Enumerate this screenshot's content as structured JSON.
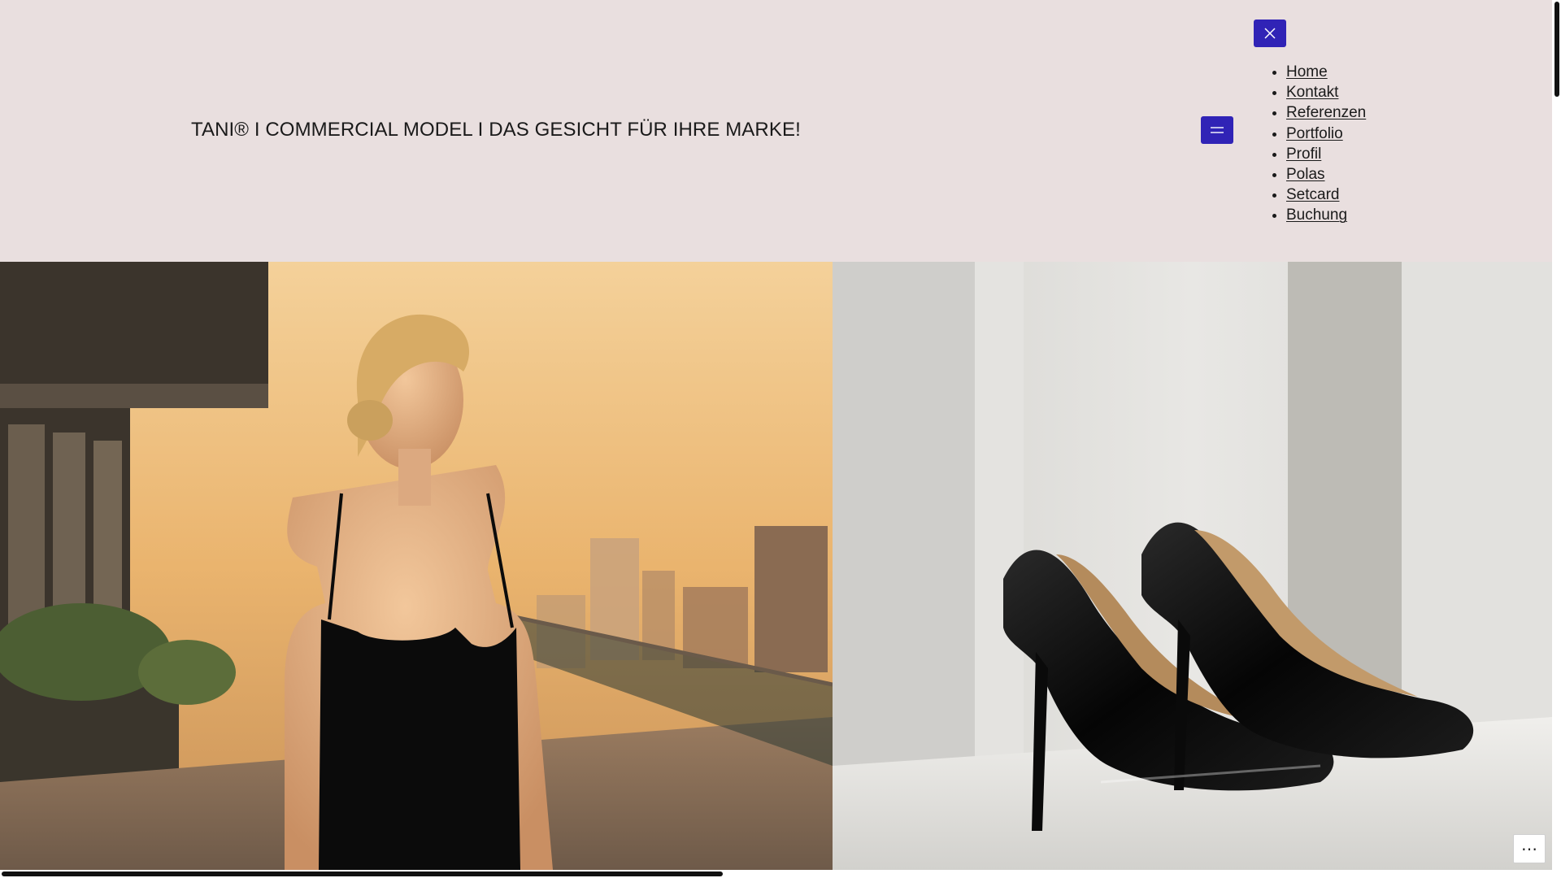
{
  "header": {
    "site_title": "TANI® I COMMERCIAL MODEL I DAS GESICHT FÜR IHRE MARKE!",
    "menu_open_icon": "hamburger-icon",
    "menu_close_icon": "close-icon"
  },
  "nav": {
    "items": [
      {
        "label": "Home"
      },
      {
        "label": "Kontakt"
      },
      {
        "label": "Referenzen"
      },
      {
        "label": "Portfolio"
      },
      {
        "label": "Profil"
      },
      {
        "label": "Polas"
      },
      {
        "label": "Setcard"
      },
      {
        "label": "Buchung"
      }
    ]
  },
  "hero": {
    "left_image": "woman-in-black-dress-on-terrace",
    "right_image": "black-patent-high-heels"
  },
  "colors": {
    "background": "#e9dfdf",
    "accent": "#3023b6",
    "text": "#1a1a1a"
  },
  "widget": {
    "more_icon": "more-dots-icon"
  }
}
